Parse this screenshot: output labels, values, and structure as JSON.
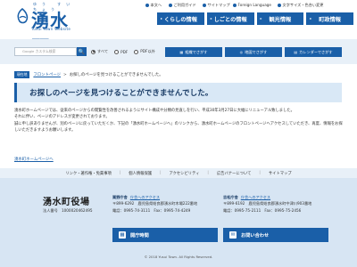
{
  "header": {
    "logo_ruby": "ゆう すい ちょう",
    "logo_jp": "湧水町",
    "logo_en": "Yusui Town Website",
    "utility": [
      {
        "label": "本文へ"
      },
      {
        "label": "ご利用ガイド"
      },
      {
        "label": "サイトマップ"
      },
      {
        "label": "Foreign Language"
      },
      {
        "label": "文字サイズ・色合い変更"
      }
    ],
    "nav": [
      {
        "label": "くらしの情報"
      },
      {
        "label": "しごとの情報"
      },
      {
        "label": "観光情報"
      },
      {
        "label": "町政情報"
      }
    ]
  },
  "search": {
    "placeholder": "Google カスタム検索",
    "button_label": "🔍",
    "radios": [
      {
        "label": "すべて",
        "checked": true
      },
      {
        "label": "PDF",
        "checked": false
      },
      {
        "label": "PDF以外",
        "checked": false
      }
    ],
    "quick_links": [
      {
        "label": "組織でさがす",
        "icon": "▦"
      },
      {
        "label": "地図でさがす",
        "icon": "◎"
      },
      {
        "label": "カレンダーでさがす",
        "icon": "▤"
      }
    ]
  },
  "breadcrumb": {
    "badge": "現在地",
    "items": [
      {
        "label": "フロントページ",
        "link": true
      },
      {
        "label": "お探しのページを見つけることができませんでした。",
        "link": false
      }
    ]
  },
  "page": {
    "title": "お探しのページを見つけることができませんでした。",
    "body": [
      "湧水町ホームページでは、従来のページからの閲覧性を改善されるようにサイト構成や分類の見直しを行い、平成30年3月27日に大幅にリニューアル致しました。",
      "それに伴い、ページのアドレスが変更されております。",
      "誠に申し訳ありませんが、別のページに戻っていただくか、下記の「湧水町ホームページへ」のリンクから、湧水町ホームページのフロントページへアクセスしていただき、再度、情報をお探しいただきますようお願いします。"
    ],
    "home_link": "湧水町ホームページへ"
  },
  "footer": {
    "links": [
      {
        "label": "リンク・著作権・免責事項"
      },
      {
        "label": "個人情報保護"
      },
      {
        "label": "アクセシビリティ"
      },
      {
        "label": "広告バナーについて"
      },
      {
        "label": "サイトマップ"
      }
    ],
    "org_name": "湧水町役場",
    "corp_number": "法人番号　1000020462495",
    "offices": [
      {
        "name": "栗野庁舎",
        "access": "庁舎へのアクセス",
        "address": "〒899-6292　鹿児島県姶良郡湧水町木場222番地",
        "phone": "電話：0995-74-3111　Fax：0995-74-4249"
      },
      {
        "name": "吉松庁舎",
        "access": "庁舎へのアクセス",
        "address": "〒899-6192　鹿児島県姶良郡湧水町中津川903番地",
        "phone": "電話：0995-75-2111　Fax：0995-75-2456"
      }
    ],
    "buttons": [
      {
        "label": "開庁時間",
        "icon": "▦"
      },
      {
        "label": "お問い合わせ",
        "icon": "✉"
      }
    ],
    "copyright": "© 2018 Yusui Town. All Rights Reserved."
  },
  "colors": {
    "primary": "#1a5fa8",
    "band": "#e8f0f8",
    "footer_bg": "#d7e5f3",
    "title_bg": "#d9e8f6"
  }
}
